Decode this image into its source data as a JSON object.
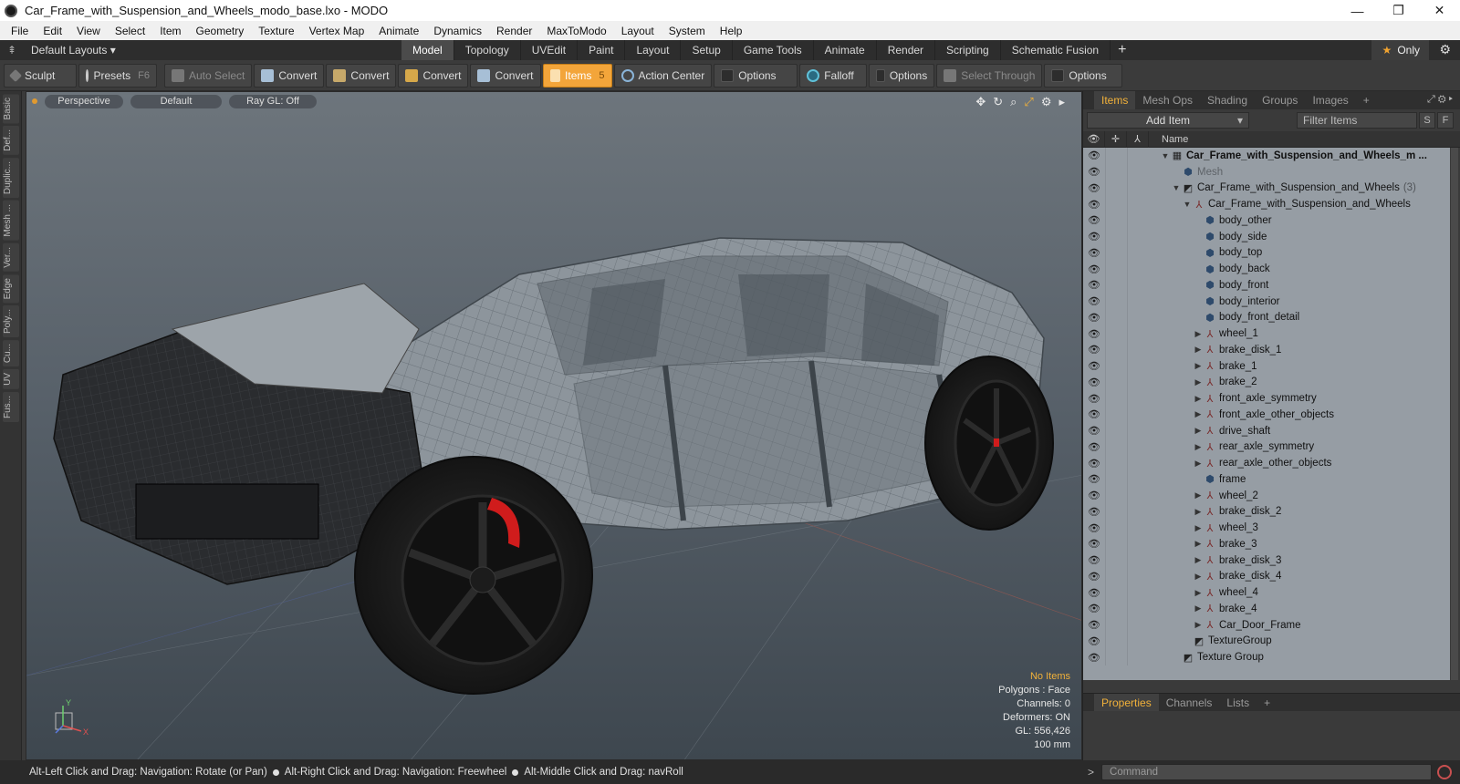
{
  "window": {
    "title": "Car_Frame_with_Suspension_and_Wheels_modo_base.lxo - MODO",
    "buttons": [
      "—",
      "❐",
      "✕"
    ]
  },
  "menu": [
    "File",
    "Edit",
    "View",
    "Select",
    "Item",
    "Geometry",
    "Texture",
    "Vertex Map",
    "Animate",
    "Dynamics",
    "Render",
    "MaxToModo",
    "Layout",
    "System",
    "Help"
  ],
  "layout_bar": {
    "layouts_label": "Default Layouts ▾",
    "tabs": [
      "Model",
      "Topology",
      "UVEdit",
      "Paint",
      "Layout",
      "Setup",
      "Game Tools",
      "Animate",
      "Render",
      "Scripting",
      "Schematic Fusion"
    ],
    "active_tab": "Model",
    "add_tab": "+",
    "only_label": "Only"
  },
  "toolbar": {
    "sculpt": "Sculpt",
    "presets": "Presets",
    "presets_key": "F6",
    "auto_select": "Auto Select",
    "convert_1": "Convert",
    "convert_2": "Convert",
    "convert_3": "Convert",
    "convert_4": "Convert",
    "items": "Items",
    "items_key": "5",
    "action_center": "Action Center",
    "options_1": "Options",
    "falloff": "Falloff",
    "options_2": "Options",
    "select_through": "Select Through",
    "options_3": "Options"
  },
  "left_tabs": [
    "Basic",
    "Def...",
    "Duplic...",
    "Mesh ...",
    "Ver...",
    "Edge",
    "Poly...",
    "Cu...",
    "UV",
    "Fus..."
  ],
  "viewport": {
    "view_mode": "Perspective",
    "shading": "Default",
    "raygl": "Ray GL: Off",
    "info": {
      "no_items": "No Items",
      "polygons": "Polygons : Face",
      "channels": "Channels: 0",
      "deformers": "Deformers: ON",
      "gl": "GL: 556,426",
      "scale": "100 mm"
    },
    "axis_labels": {
      "y": "Y",
      "x": "X"
    }
  },
  "items_panel": {
    "tabs": [
      "Items",
      "Mesh Ops",
      "Shading",
      "Groups",
      "Images"
    ],
    "active_tab": "Items",
    "add_tab": "+",
    "add_item": "Add Item",
    "filter_placeholder": "Filter Items",
    "s_button": "S",
    "f_button": "F",
    "name_header": "Name",
    "tree": [
      {
        "label": "Car_Frame_with_Suspension_and_Wheels_m ...",
        "depth": 0,
        "type": "scene",
        "expander": "▼",
        "root": true
      },
      {
        "label": "Mesh",
        "depth": 1,
        "type": "mesh",
        "expander": "",
        "dim": true
      },
      {
        "label": "Car_Frame_with_Suspension_and_Wheels",
        "count": "(3)",
        "depth": 1,
        "type": "group",
        "expander": "▼"
      },
      {
        "label": "Car_Frame_with_Suspension_and_Wheels",
        "depth": 2,
        "type": "locator",
        "expander": "▼"
      },
      {
        "label": "body_other",
        "depth": 3,
        "type": "mesh",
        "expander": ""
      },
      {
        "label": "body_side",
        "depth": 3,
        "type": "mesh",
        "expander": ""
      },
      {
        "label": "body_top",
        "depth": 3,
        "type": "mesh",
        "expander": ""
      },
      {
        "label": "body_back",
        "depth": 3,
        "type": "mesh",
        "expander": ""
      },
      {
        "label": "body_front",
        "depth": 3,
        "type": "mesh",
        "expander": ""
      },
      {
        "label": "body_interior",
        "depth": 3,
        "type": "mesh",
        "expander": ""
      },
      {
        "label": "body_front_detail",
        "depth": 3,
        "type": "mesh",
        "expander": ""
      },
      {
        "label": "wheel_1",
        "depth": 3,
        "type": "locator",
        "expander": "▶"
      },
      {
        "label": "brake_disk_1",
        "depth": 3,
        "type": "locator",
        "expander": "▶"
      },
      {
        "label": "brake_1",
        "depth": 3,
        "type": "locator",
        "expander": "▶"
      },
      {
        "label": "brake_2",
        "depth": 3,
        "type": "locator",
        "expander": "▶"
      },
      {
        "label": "front_axle_symmetry",
        "depth": 3,
        "type": "locator",
        "expander": "▶"
      },
      {
        "label": "front_axle_other_objects",
        "depth": 3,
        "type": "locator",
        "expander": "▶"
      },
      {
        "label": "drive_shaft",
        "depth": 3,
        "type": "locator",
        "expander": "▶"
      },
      {
        "label": "rear_axle_symmetry",
        "depth": 3,
        "type": "locator",
        "expander": "▶"
      },
      {
        "label": "rear_axle_other_objects",
        "depth": 3,
        "type": "locator",
        "expander": "▶"
      },
      {
        "label": "frame",
        "depth": 3,
        "type": "mesh",
        "expander": ""
      },
      {
        "label": "wheel_2",
        "depth": 3,
        "type": "locator",
        "expander": "▶"
      },
      {
        "label": "brake_disk_2",
        "depth": 3,
        "type": "locator",
        "expander": "▶"
      },
      {
        "label": "wheel_3",
        "depth": 3,
        "type": "locator",
        "expander": "▶"
      },
      {
        "label": "brake_3",
        "depth": 3,
        "type": "locator",
        "expander": "▶"
      },
      {
        "label": "brake_disk_3",
        "depth": 3,
        "type": "locator",
        "expander": "▶"
      },
      {
        "label": "brake_disk_4",
        "depth": 3,
        "type": "locator",
        "expander": "▶"
      },
      {
        "label": "wheel_4",
        "depth": 3,
        "type": "locator",
        "expander": "▶"
      },
      {
        "label": "brake_4",
        "depth": 3,
        "type": "locator",
        "expander": "▶"
      },
      {
        "label": "Car_Door_Frame",
        "depth": 3,
        "type": "locator",
        "expander": "▶"
      },
      {
        "label": "TextureGroup",
        "depth": 2,
        "type": "group",
        "expander": ""
      },
      {
        "label": "Texture Group",
        "depth": 1,
        "type": "group",
        "expander": ""
      }
    ]
  },
  "properties_panel": {
    "tabs": [
      "Properties",
      "Channels",
      "Lists"
    ],
    "active_tab": "Properties",
    "add_tab": "+"
  },
  "status": {
    "hint_1": "Alt-Left Click and Drag: Navigation: Rotate (or Pan)",
    "hint_2": "Alt-Right Click and Drag: Navigation: Freewheel",
    "hint_3": "Alt-Middle Click and Drag: navRoll"
  },
  "command": {
    "prompt": ">",
    "placeholder": "Command"
  },
  "colors": {
    "accent": "#f3a53a",
    "tree_bg": "#969da4",
    "viewport_top": "#6d757c",
    "viewport_bottom": "#3e474f",
    "brake_caliper": "#d01c1c"
  }
}
